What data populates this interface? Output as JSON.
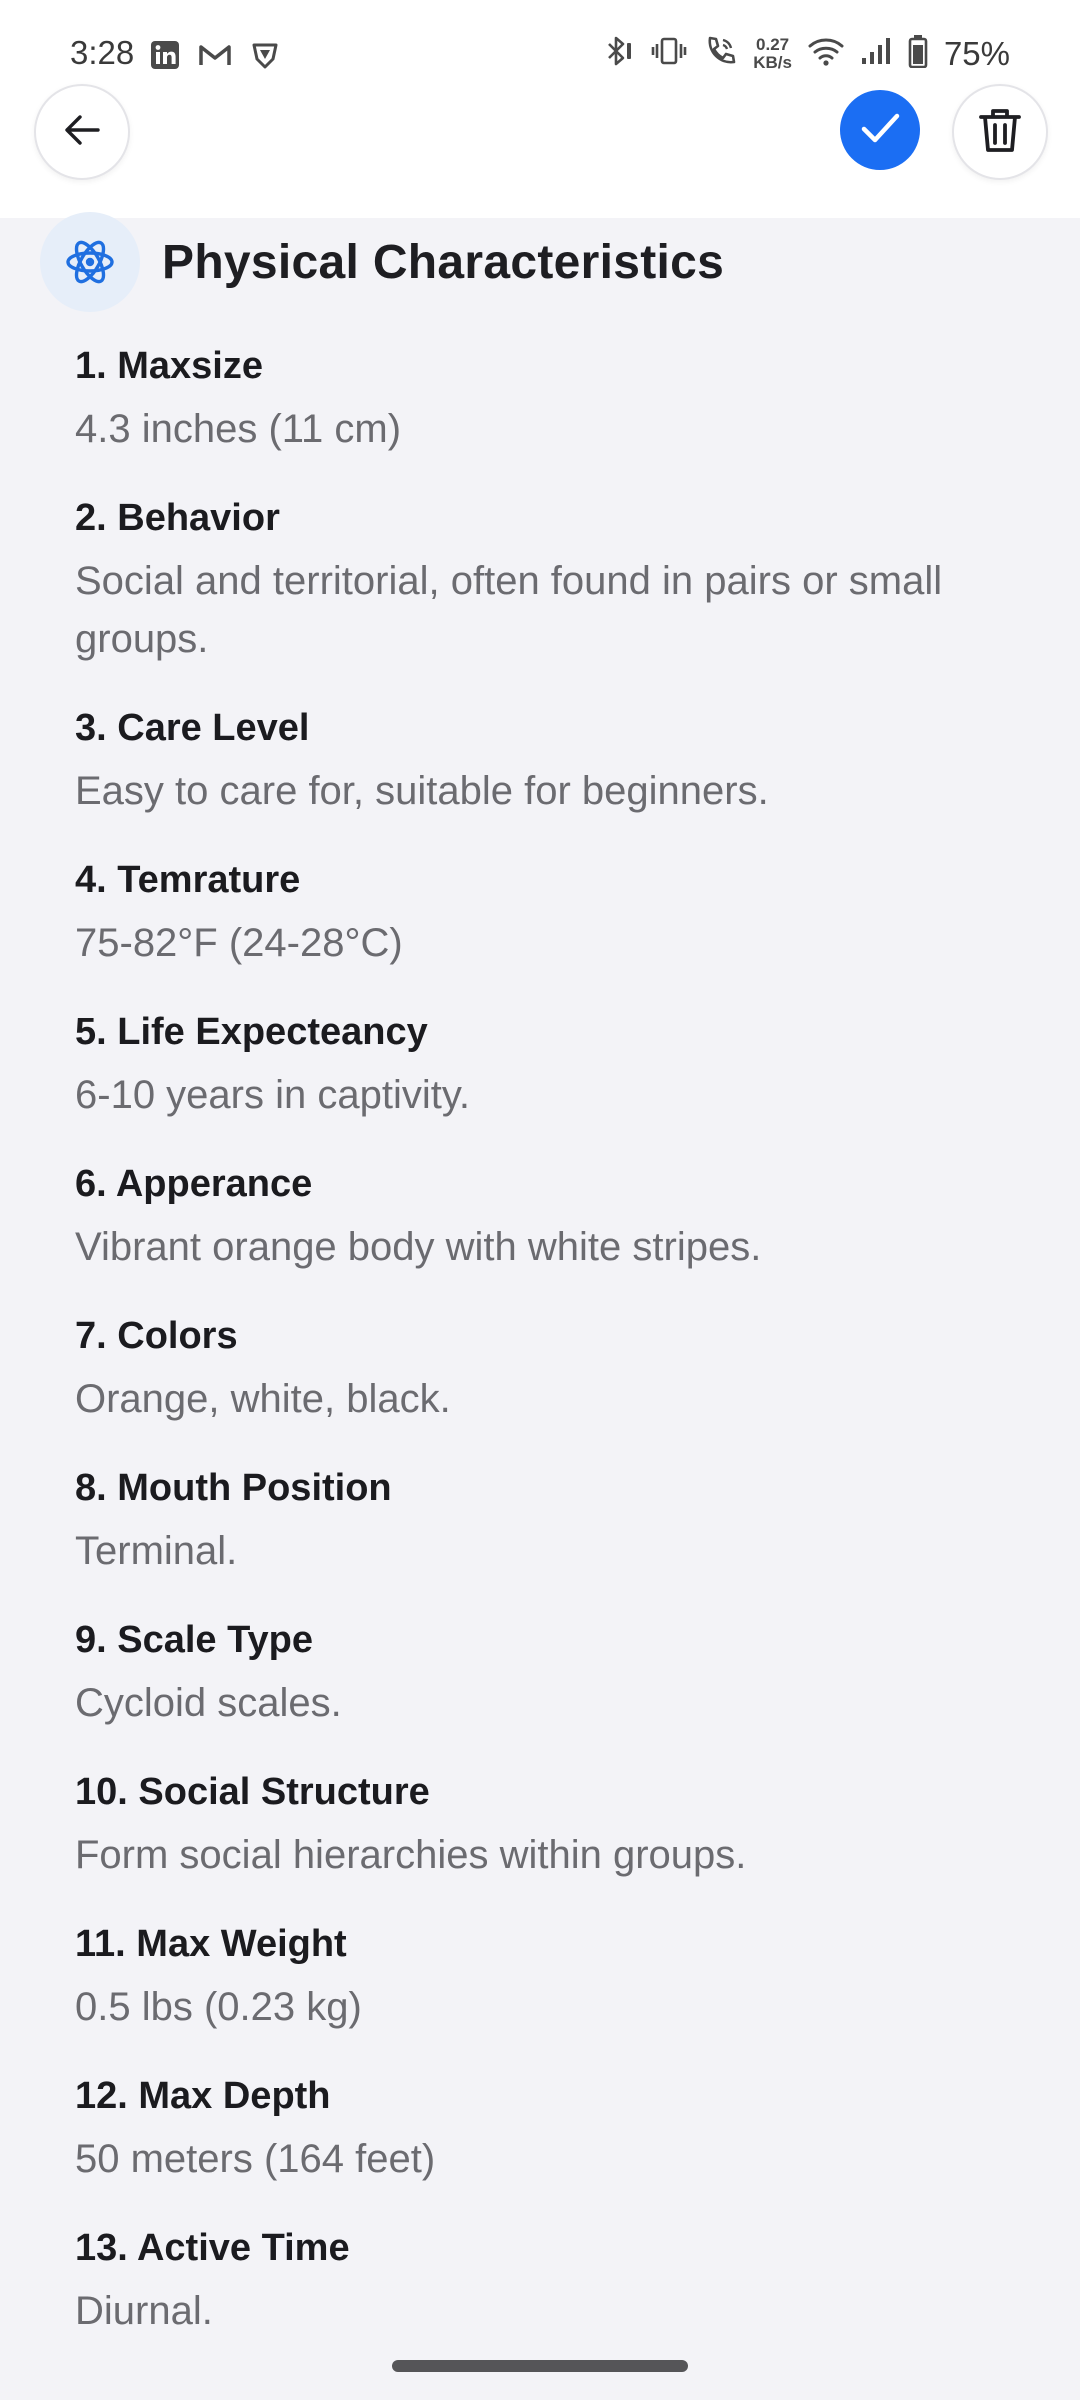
{
  "status_bar": {
    "time": "3:28",
    "net_speed_value": "0.27",
    "net_speed_unit": "KB/s",
    "battery": "75%",
    "left_icons": [
      "linkedin-icon",
      "gmail-icon",
      "shield-icon"
    ],
    "right_icons": [
      "bluetooth-icon",
      "vibrate-icon",
      "call-icon",
      "wifi-icon",
      "signal-icon",
      "battery-icon"
    ]
  },
  "header": {
    "back_icon": "arrow-left-icon",
    "confirm_icon": "check-icon",
    "delete_icon": "trash-icon"
  },
  "section": {
    "icon": "atom-icon",
    "title": "Physical Characteristics"
  },
  "items": [
    {
      "title": "1. Maxsize",
      "value": "4.3 inches (11 cm)"
    },
    {
      "title": "2. Behavior",
      "value": "Social and territorial, often found in pairs or small groups."
    },
    {
      "title": "3. Care Level",
      "value": "Easy to care for, suitable for beginners."
    },
    {
      "title": "4. Temrature",
      "value": "75-82°F (24-28°C)"
    },
    {
      "title": "5. Life Expecteancy",
      "value": "6-10 years in captivity."
    },
    {
      "title": "6. Apperance",
      "value": "Vibrant orange body with white stripes."
    },
    {
      "title": "7. Colors",
      "value": "Orange, white, black."
    },
    {
      "title": "8. Mouth Position",
      "value": "Terminal."
    },
    {
      "title": "9. Scale Type",
      "value": "Cycloid scales."
    },
    {
      "title": "10. Social Structure",
      "value": "Form social hierarchies within groups."
    },
    {
      "title": "11. Max Weight",
      "value": "0.5 lbs (0.23 kg)"
    },
    {
      "title": "12. Max Depth",
      "value": "50 meters (164 feet)"
    },
    {
      "title": "13. Active Time",
      "value": "Diurnal."
    }
  ],
  "colors": {
    "accent": "#1b6ef3",
    "background": "#f3f3f7",
    "title_text": "#1b1b1f",
    "value_text": "#6b6b70"
  }
}
